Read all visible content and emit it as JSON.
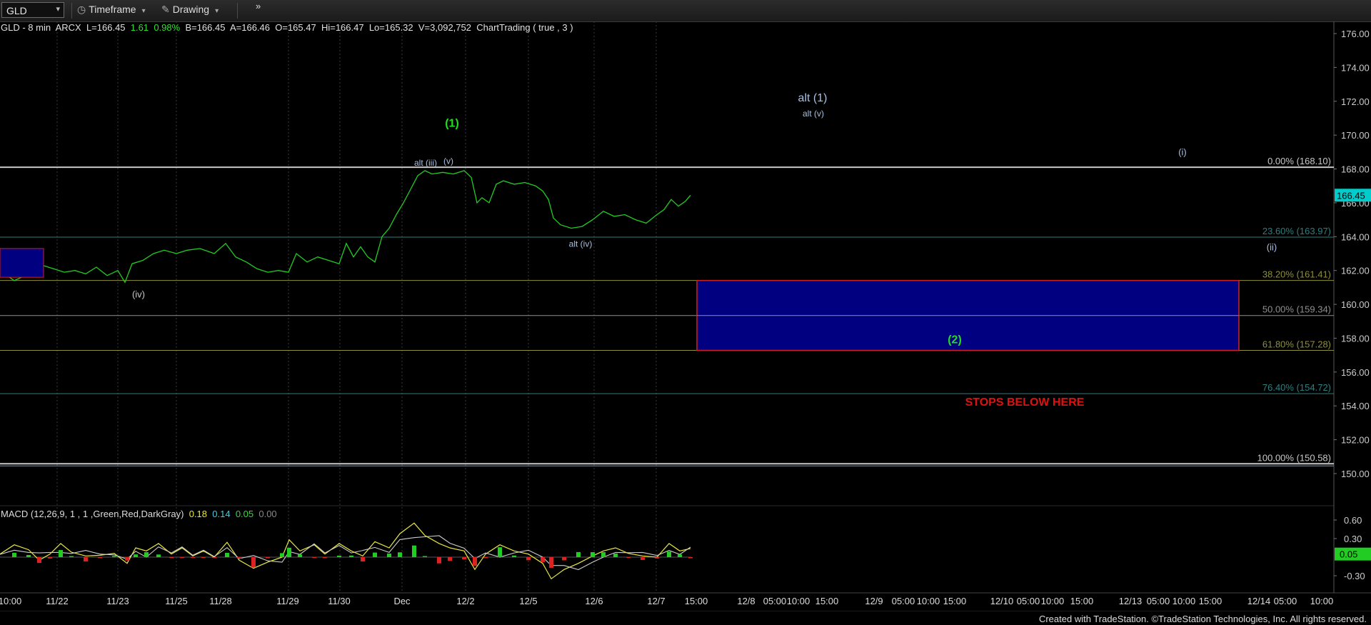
{
  "toolbar": {
    "symbol": "GLD",
    "timeframe_label": "Timeframe",
    "drawing_label": "Drawing",
    "more_label": "»"
  },
  "info_bar": {
    "symbol": "GLD - 8 min",
    "exchange": "ARCX",
    "last": "L=166.45",
    "change": "1.61",
    "change_pct": "0.98%",
    "bid": "B=166.45",
    "ask": "A=166.46",
    "open": "O=165.47",
    "high": "Hi=166.47",
    "low": "Lo=165.32",
    "volume": "V=3,092,752",
    "study": "ChartTrading ( true , 3 )"
  },
  "macd_bar": {
    "label": "MACD (12,26,9, 1 , 1 ,Green,Red,DarkGray)",
    "v1": "0.18",
    "v2": "0.14",
    "v3": "0.05",
    "v4": "0.00"
  },
  "price_axis": {
    "ticks": [
      {
        "value": 176,
        "label": "176.00"
      },
      {
        "value": 174,
        "label": "174.00"
      },
      {
        "value": 172,
        "label": "172.00"
      },
      {
        "value": 170,
        "label": "170.00"
      },
      {
        "value": 168,
        "label": "168.00"
      },
      {
        "value": 166,
        "label": "166.00"
      },
      {
        "value": 164,
        "label": "164.00"
      },
      {
        "value": 162,
        "label": "162.00"
      },
      {
        "value": 160,
        "label": "160.00"
      },
      {
        "value": 158,
        "label": "158.00"
      },
      {
        "value": 156,
        "label": "156.00"
      },
      {
        "value": 154,
        "label": "154.00"
      },
      {
        "value": 152,
        "label": "152.00"
      },
      {
        "value": 150,
        "label": "150.00"
      }
    ],
    "last_price": {
      "value": 166.45,
      "label": "166.45"
    }
  },
  "macd_axis": {
    "ticks": [
      {
        "value": 0.6,
        "label": "0.60"
      },
      {
        "value": 0.3,
        "label": "0.30"
      },
      {
        "value": -0.3,
        "label": "-0.30"
      }
    ],
    "last": {
      "value": 0.05,
      "label": "0.05"
    }
  },
  "time_axis": {
    "labels": [
      {
        "label": "10:00",
        "pos": 0
      },
      {
        "label": "11/22",
        "pos": 1
      },
      {
        "label": "11/23",
        "pos": 2
      },
      {
        "label": "11/25",
        "pos": 3
      },
      {
        "label": "11/28",
        "pos": 4
      },
      {
        "label": "11/29",
        "pos": 5
      },
      {
        "label": "11/30",
        "pos": 6
      },
      {
        "label": "Dec",
        "pos": 7
      },
      {
        "label": "12/2",
        "pos": 8
      },
      {
        "label": "12/5",
        "pos": 9
      },
      {
        "label": "12/6",
        "pos": 10
      },
      {
        "label": "12/7",
        "pos": 11
      },
      {
        "label": "15:00",
        "pos": 12
      },
      {
        "label": "12/8",
        "pos": 13
      },
      {
        "label": "05:00",
        "pos": 14
      },
      {
        "label": "10:00",
        "pos": 15
      },
      {
        "label": "15:00",
        "pos": 16
      },
      {
        "label": "12/9",
        "pos": 17
      },
      {
        "label": "05:00",
        "pos": 18
      },
      {
        "label": "10:00",
        "pos": 19
      },
      {
        "label": "15:00",
        "pos": 20
      },
      {
        "label": "12/10",
        "pos": 21
      },
      {
        "label": "05:00",
        "pos": 22
      },
      {
        "label": "10:00",
        "pos": 23
      },
      {
        "label": "15:00",
        "pos": 24
      },
      {
        "label": "12/13",
        "pos": 25
      },
      {
        "label": "05:00",
        "pos": 26
      },
      {
        "label": "10:00",
        "pos": 27
      },
      {
        "label": "15:00",
        "pos": 28
      },
      {
        "label": "12/14",
        "pos": 29
      },
      {
        "label": "05:00",
        "pos": 30
      },
      {
        "label": "10:00",
        "pos": 31
      }
    ]
  },
  "fib_levels": [
    {
      "pct": "0.00%",
      "price": 168.1,
      "label": "0.00% (168.10)",
      "color": "#c8c8c8"
    },
    {
      "pct": "23.60%",
      "price": 163.97,
      "label": "23.60% (163.97)",
      "color": "#2d7f7f"
    },
    {
      "pct": "38.20%",
      "price": 161.41,
      "label": "38.20% (161.41)",
      "color": "#8f8f3a"
    },
    {
      "pct": "50.00%",
      "price": 159.34,
      "label": "50.00% (159.34)",
      "color": "#8f8f8f"
    },
    {
      "pct": "61.80%",
      "price": 157.28,
      "label": "61.80% (157.28)",
      "color": "#8f8f3a"
    },
    {
      "pct": "76.40%",
      "price": 154.72,
      "label": "76.40% (154.72)",
      "color": "#2d7f7f"
    },
    {
      "pct": "100.00%",
      "price": 150.58,
      "label": "100.00% (150.58)",
      "color": "#c8c8c8"
    }
  ],
  "wave_labels": [
    {
      "text": "(1)",
      "color": "#22dd22",
      "bold": true
    },
    {
      "text": "alt (iii)",
      "color": "#a8c0e0"
    },
    {
      "text": "(v)",
      "color": "#a8c0e0"
    },
    {
      "text": "(iv)",
      "color": "#c8c8c8"
    },
    {
      "text": "alt (iv)",
      "color": "#a8c0e0"
    },
    {
      "text": "alt (1)",
      "color": "#a8c0e0"
    },
    {
      "text": "alt (v)",
      "color": "#a8c0e0"
    },
    {
      "text": "(i)",
      "color": "#a8c0e0"
    },
    {
      "text": "(ii)",
      "color": "#a8c0e0"
    },
    {
      "text": "(2)",
      "color": "#22dd22",
      "bold": true
    }
  ],
  "annotations": {
    "stops_text": "STOPS BELOW HERE",
    "stops_color": "#dd1111",
    "target_box_color": "#000080",
    "target_box_border": "#cc2222",
    "target_box_high": 161.41,
    "target_box_low": 157.28
  },
  "colors": {
    "price_line": "#22cc22",
    "macd_line": "#e8e840",
    "signal_line": "#cccccc",
    "hist_pos": "#22cc22",
    "hist_neg": "#dd2222",
    "last_price_bg": "#00cccc"
  },
  "footer": {
    "text": "Created with TradeStation. ©TradeStation Technologies, Inc. All rights reserved."
  }
}
